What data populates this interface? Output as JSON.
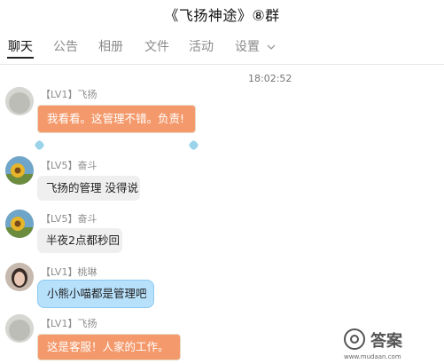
{
  "title": "《飞扬神途》⑧群",
  "tabs": [
    {
      "label": "聊天"
    },
    {
      "label": "公告"
    },
    {
      "label": "相册"
    },
    {
      "label": "文件"
    },
    {
      "label": "活动"
    },
    {
      "label": "设置"
    }
  ],
  "timestamp": "18:02:52",
  "messages": [
    {
      "sender": "【LV1】飞扬",
      "text": "我看看。这管理不错。负责!",
      "bubble_color": "#f4996b"
    },
    {
      "sender": "【LV5】奋斗",
      "text": "飞扬的管理 没得说",
      "bubble_color": "#efefef"
    },
    {
      "sender": "【LV5】奋斗",
      "text": "半夜2点都秒回",
      "bubble_color": "#efefef"
    },
    {
      "sender": "【LV1】桃琳",
      "text": "小熊小喵都是管理吧",
      "bubble_color": "#b7e0fb"
    },
    {
      "sender": "【LV1】飞扬",
      "text": "这是客服！人家的工作。",
      "bubble_color": "#f4996b"
    }
  ],
  "watermark": {
    "text": "答案",
    "url": "www.mudaan.com"
  }
}
